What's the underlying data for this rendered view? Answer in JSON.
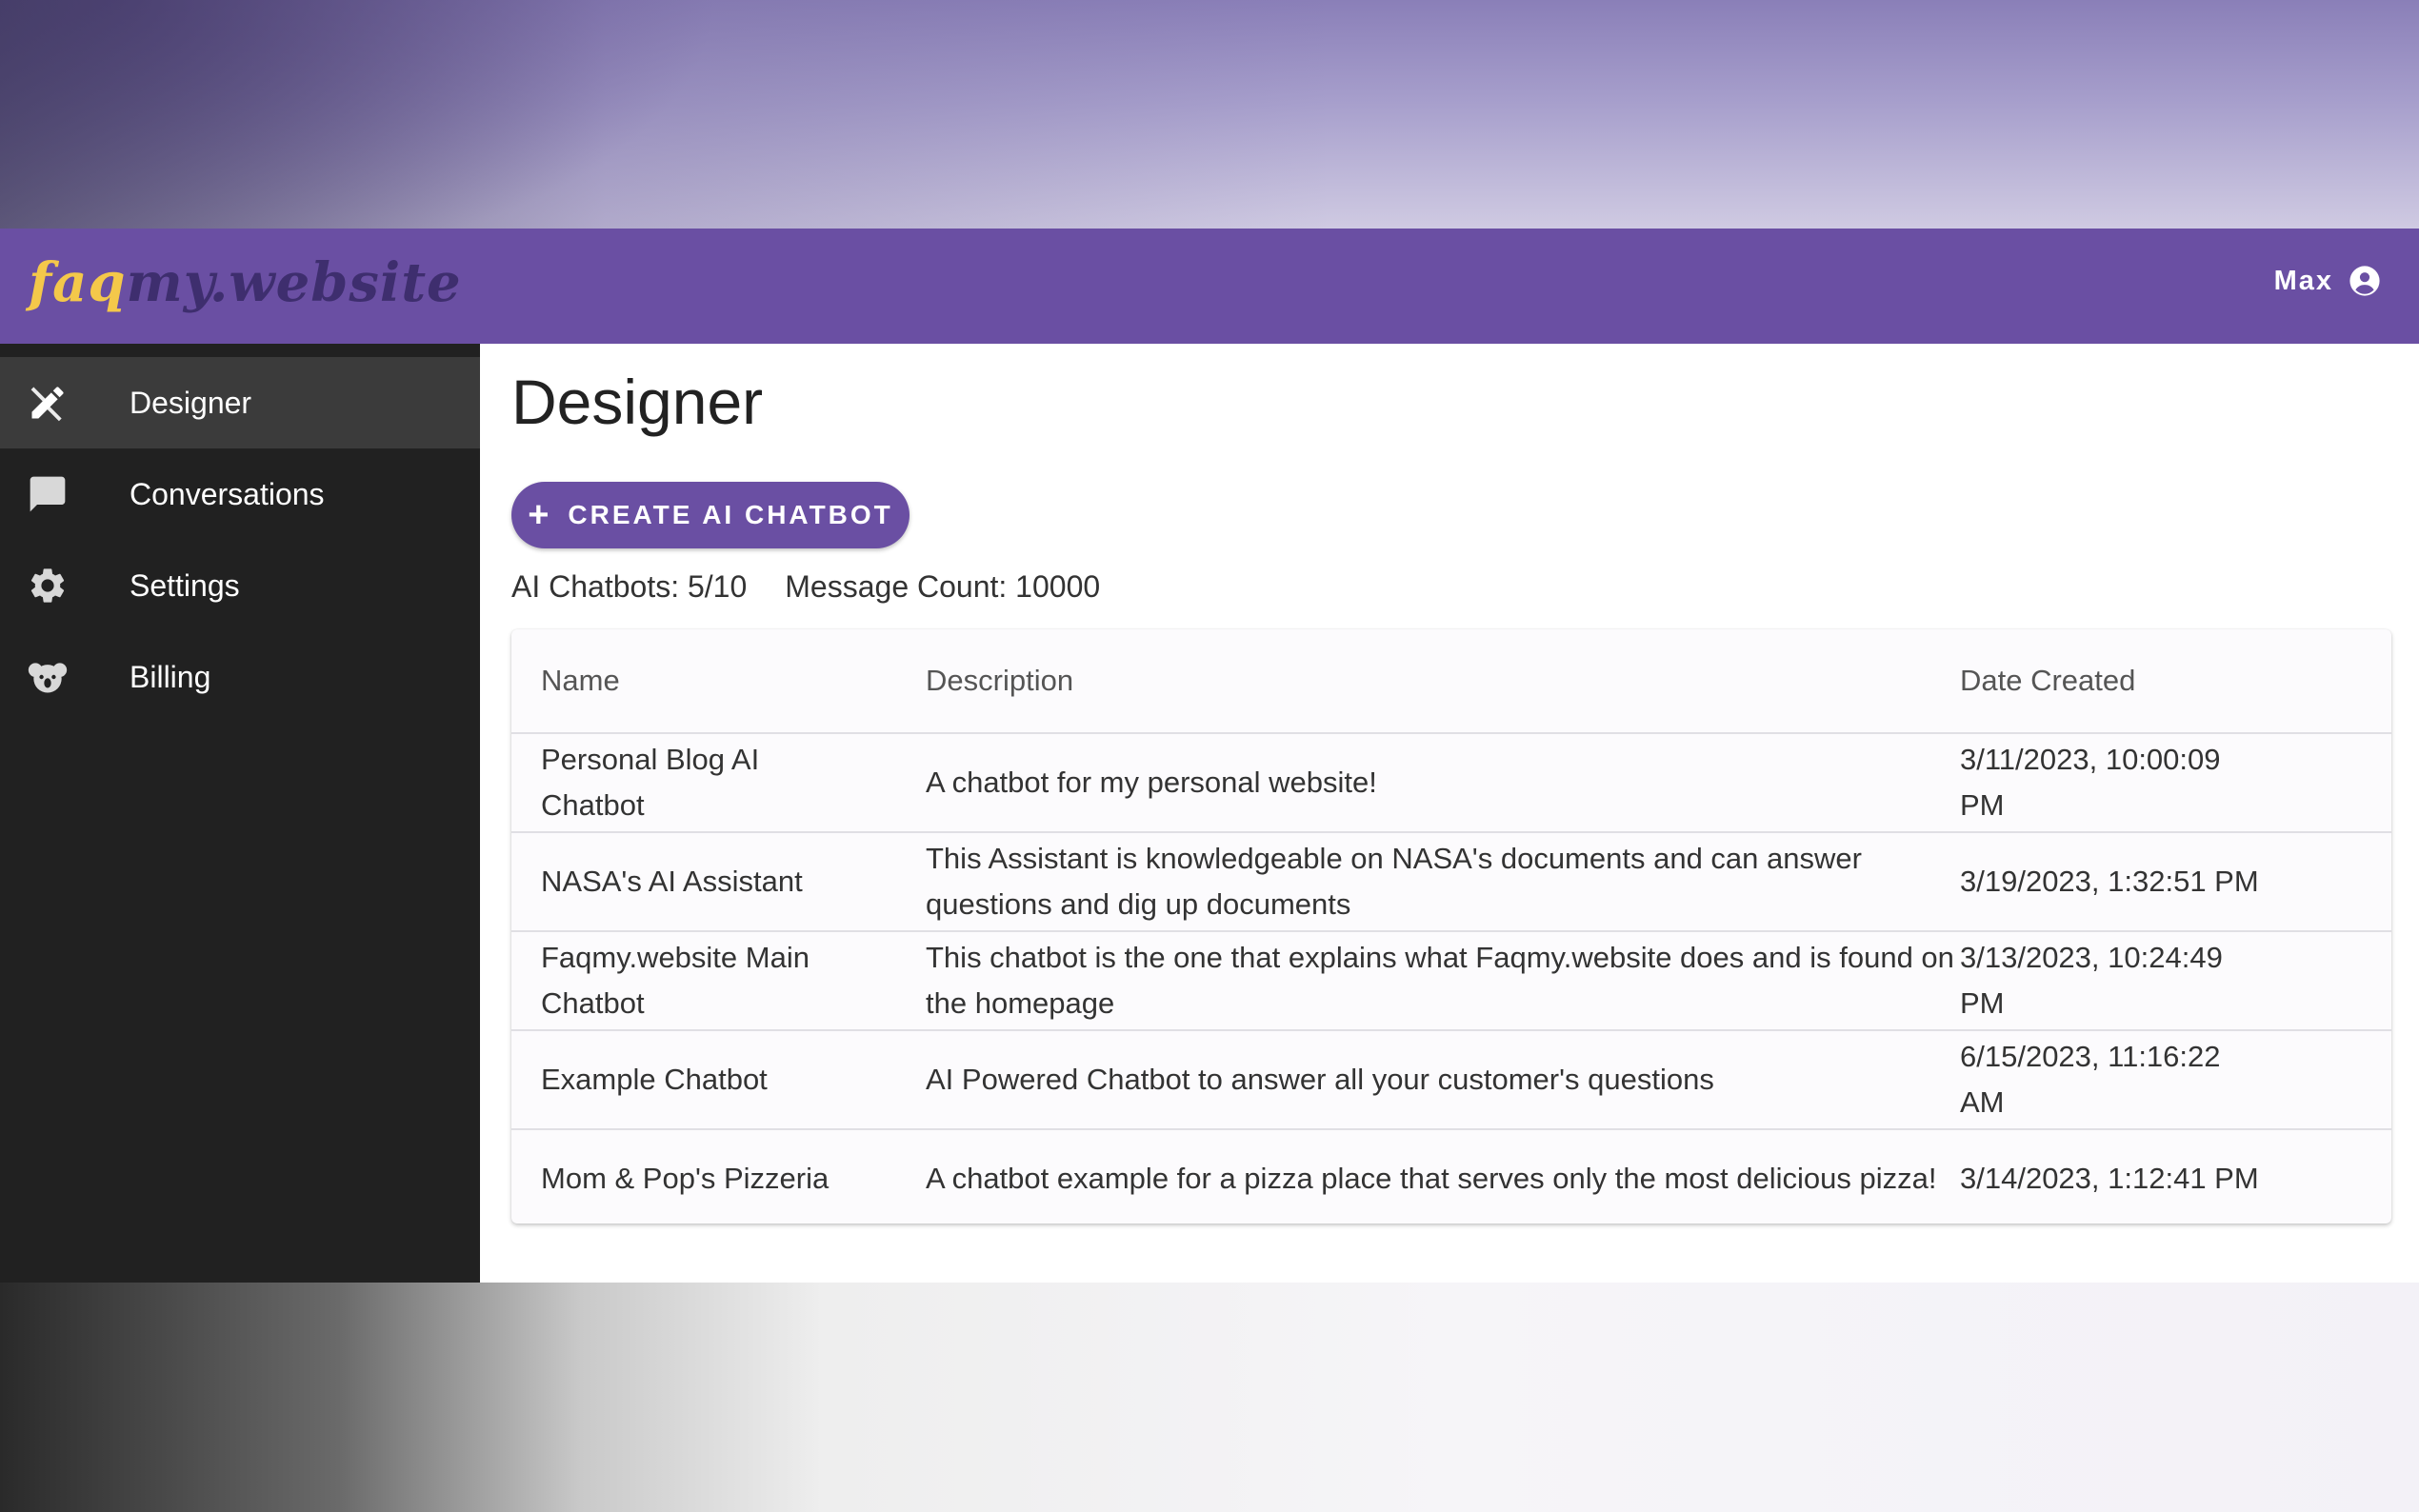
{
  "header": {
    "logo_part1": "faq",
    "logo_part2": "my.website",
    "user_name": "Max"
  },
  "sidebar": {
    "items": [
      {
        "label": "Designer",
        "icon": "design-tools-icon",
        "active": true
      },
      {
        "label": "Conversations",
        "icon": "chat-bubble-icon",
        "active": false
      },
      {
        "label": "Settings",
        "icon": "gear-icon",
        "active": false
      },
      {
        "label": "Billing",
        "icon": "koala-icon",
        "active": false
      }
    ]
  },
  "main": {
    "title": "Designer",
    "create_button_label": "CREATE AI CHATBOT",
    "stats": {
      "chatbots": "AI Chatbots: 5/10",
      "messages": "Message Count: 10000"
    },
    "table": {
      "headers": [
        "Name",
        "Description",
        "Date Created"
      ],
      "rows": [
        {
          "name": "Personal Blog AI Chatbot",
          "description": "A chatbot for my personal website!",
          "date": "3/11/2023, 10:00:09 PM"
        },
        {
          "name": "NASA's AI Assistant",
          "description": "This Assistant is knowledgeable on NASA's documents and can answer questions and dig up documents",
          "date": "3/19/2023, 1:32:51 PM"
        },
        {
          "name": "Faqmy.website Main Chatbot",
          "description": "This chatbot is the one that explains what Faqmy.website does and is found on the homepage",
          "date": "3/13/2023, 10:24:49 PM"
        },
        {
          "name": "Example Chatbot",
          "description": "AI Powered Chatbot to answer all your customer's questions",
          "date": "6/15/2023, 11:16:22 AM"
        },
        {
          "name": "Mom & Pop's Pizzeria",
          "description": "A chatbot example for a pizza place that serves only the most delicious pizza!",
          "date": "3/14/2023, 1:12:41 PM"
        }
      ]
    }
  },
  "colors": {
    "brand_purple": "#6a4fa3",
    "logo_yellow": "#f4c84a",
    "sidebar_bg": "#212121"
  }
}
